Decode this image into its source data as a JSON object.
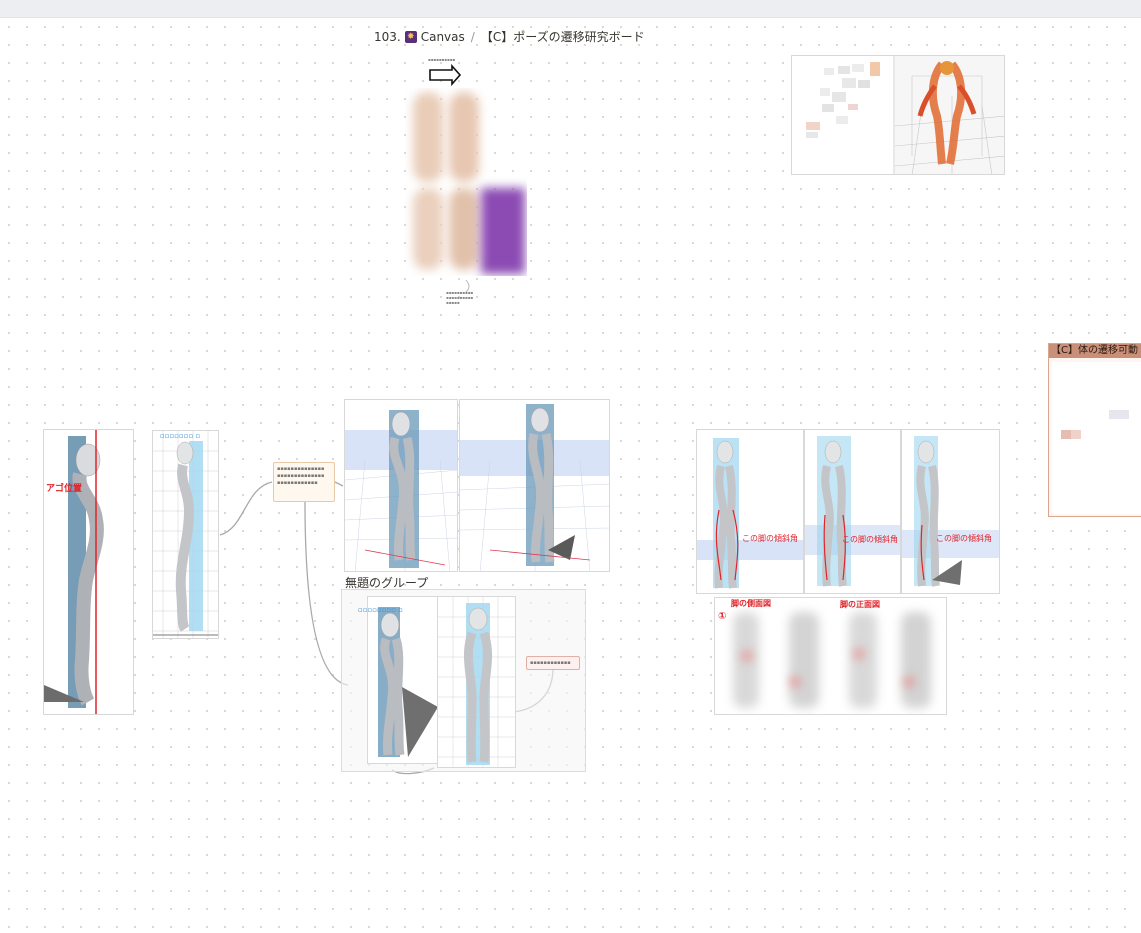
{
  "breadcrumb": {
    "number": "103.",
    "icon": "canvas-icon",
    "canvas_label": "Canvas",
    "separator": "/",
    "board_title": "【C】ポーズの遷移研究ボード"
  },
  "board": {
    "group_title": "無題のグループ",
    "side_card_title": "【C】体の遷移可動",
    "labels": {
      "jaw_position": "アゴ位置",
      "leg_side_view": "脚の側面図",
      "leg_front_view": "脚の正面図",
      "leg_angle_1": "この脚の傾斜角",
      "leg_angle_2": "この脚の傾斜角",
      "leg_angle_3": "この脚の傾斜角",
      "circle_one": "①"
    }
  },
  "colors": {
    "topbar": "#eceef2",
    "accent_red": "#e0242a",
    "accent_blue": "#3a8fd8",
    "note_border": "#e9c9a7",
    "side_card_header": "#c98f78"
  }
}
